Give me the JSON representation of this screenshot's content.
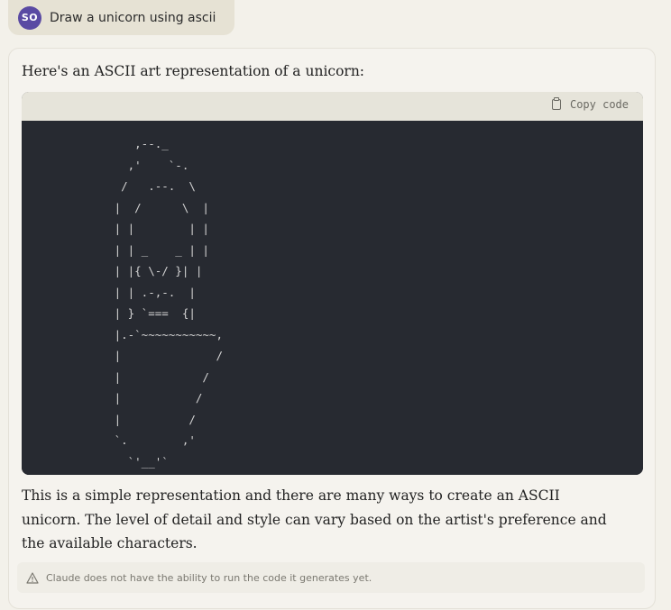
{
  "user_message": {
    "avatar_initials": "SO",
    "text": "Draw a unicorn using ascii"
  },
  "response": {
    "intro": "Here's an ASCII art representation of a unicorn:",
    "code_block": {
      "copy_label": "Copy code",
      "copy_icon": "clipboard-icon",
      "ascii_art": "      ,--._\n     ,'    `-.\n    /   .--.  \\\n   |  /      \\  |\n   | |        | |\n   | | _    _ | |\n   | |{ \\-/ }| |\n   | | .-,-.  |\n   | } `===  {|\n   |.-`~~~~~~~~~~~,\n   |              /\n   |            /\n   |           /\n   |          /\n   `.        ,'\n     `'__'`"
    },
    "closing": "This is a simple representation and there are many ways to create an ASCII unicorn. The level of detail and style can vary based on the artist's preference and the available characters.",
    "disclaimer": "Claude does not have the ability to run the code it generates yet.",
    "disclaimer_icon": "warning-icon"
  },
  "colors": {
    "page_bg": "#f3f1ea",
    "avatar": "#5a4aa3",
    "code_bg": "#272a31",
    "code_header_bg": "#e6e4da"
  }
}
